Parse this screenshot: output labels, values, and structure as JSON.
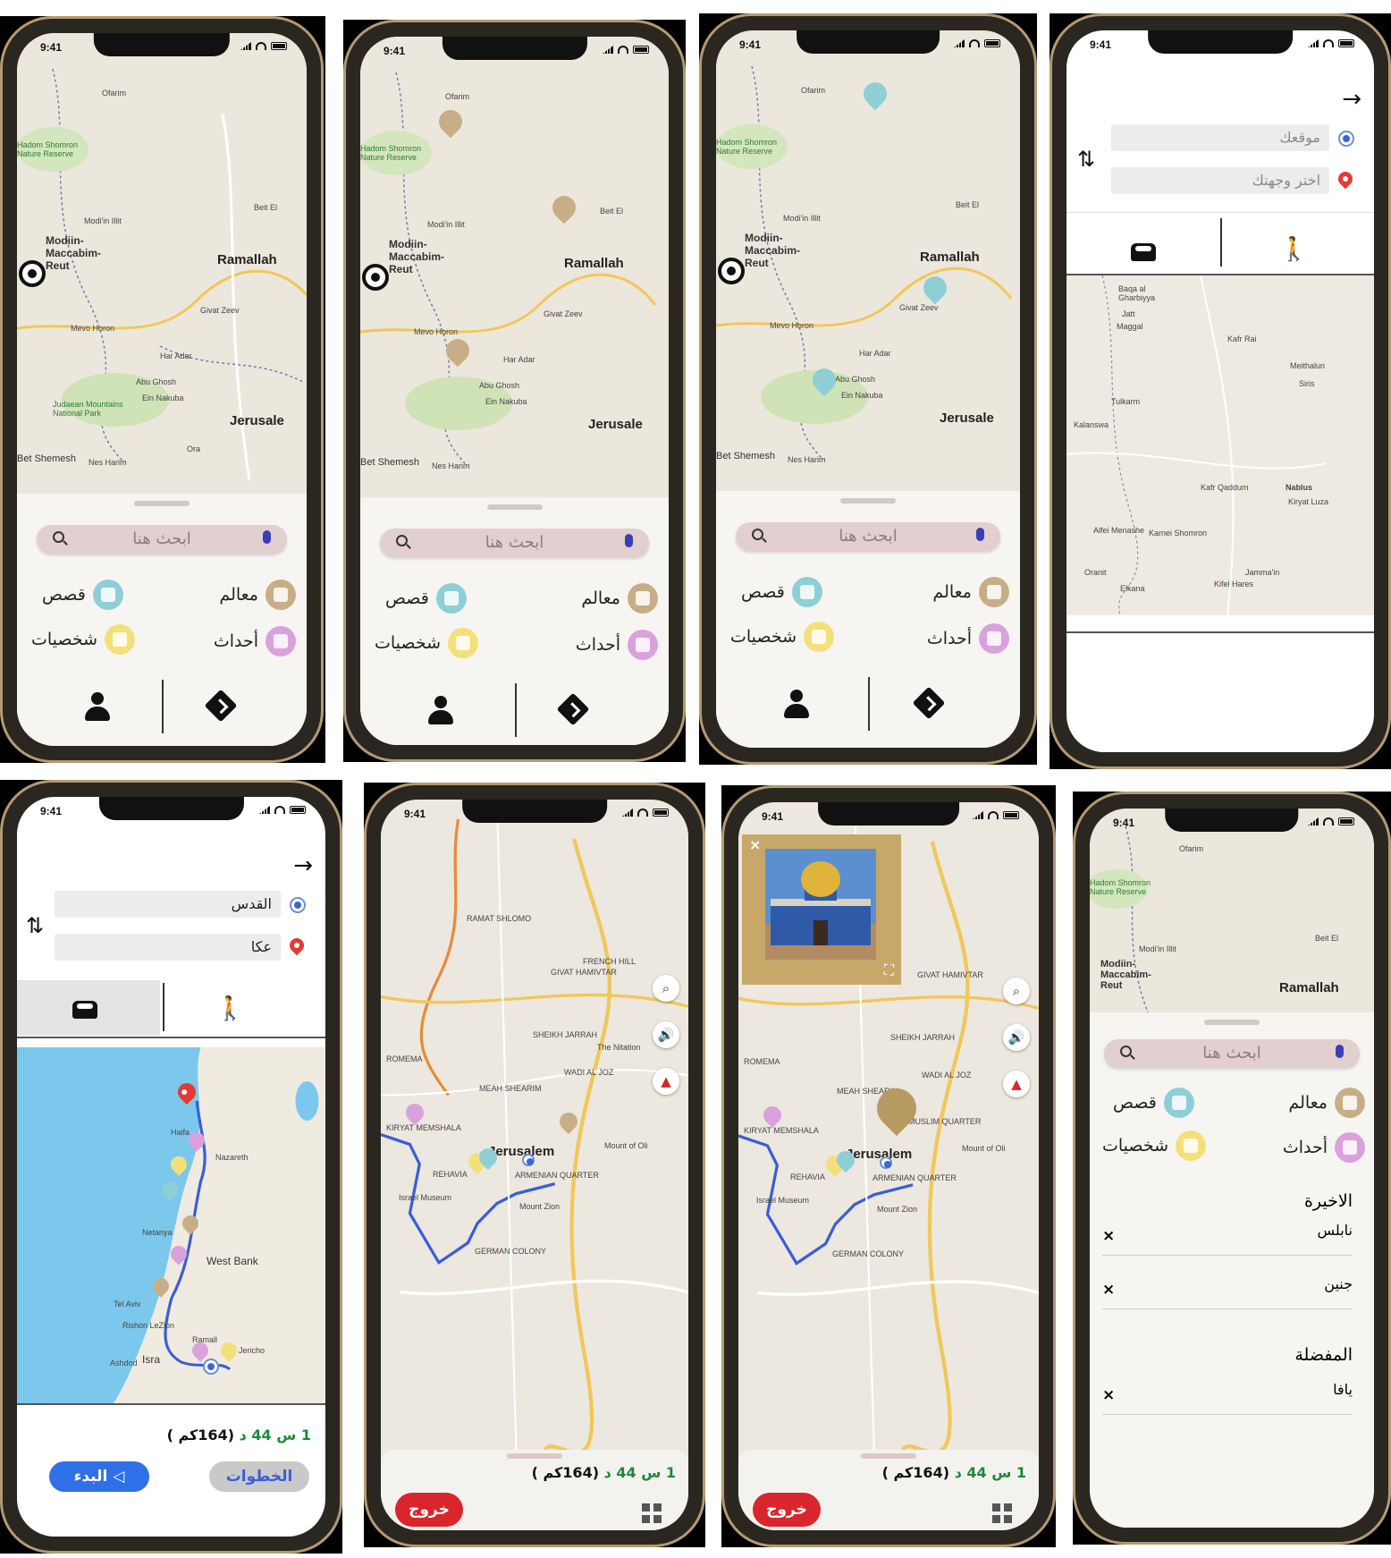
{
  "status_time": "9:41",
  "explore": {
    "search_placeholder": "ابحث هنا",
    "categories": {
      "monuments": "معالم",
      "stories": "قصص",
      "events": "أحداث",
      "persons": "شخصيات"
    },
    "map_labels": {
      "ofarim": "Ofarim",
      "hadom": "Hadom Shomron Nature Reserve",
      "modiin_illit": "Modi'in Illit",
      "modiin": "Modiin-Maccabim-Reut",
      "beit_el": "Beit El",
      "ramallah": "Ramallah",
      "givat_zeev": "Givat Zeev",
      "mevo_horon": "Mevo Horon",
      "har_adar": "Har Adar",
      "abu_ghosh": "Abu Ghosh",
      "ein_nakuba": "Ein Nakuba",
      "judaean": "Judaean Mountains National Park",
      "jerusalem": "Jerusale",
      "ora": "Ora",
      "bet_shemesh": "Bet Shemesh",
      "nes_harim": "Nes Harim"
    }
  },
  "route_empty": {
    "origin_placeholder": "موقعك",
    "destination_placeholder": "اختر وجهتك",
    "map_labels": {
      "baqa": "Baqa al Gharbiyya",
      "jatt": "Jatt",
      "maggal": "Maggal",
      "kafr_rai": "Kafr Rai",
      "meithalun": "Meithalun",
      "siris": "Siris",
      "tulkarm": "Tulkarm",
      "kalansua": "Kalanswa",
      "kafr_qaddum": "Kafr Qaddum",
      "nablus": "Nablus",
      "kiryat_luza": "Kiryat Luza",
      "alfei_menashe": "Alfei Menashe",
      "karnei": "Karnei Shomron",
      "oranit": "Oranit",
      "jammain": "Jamma'in",
      "elkana": "Elkana",
      "kfar_hares": "Kifel Hares"
    }
  },
  "route_filled": {
    "origin_value": "القدس",
    "destination_value": "عكا",
    "map_labels": {
      "haifa": "Haifa",
      "nazareth": "Nazareth",
      "netanya": "Netanya",
      "west_bank": "West Bank",
      "tel_aviv": "Tel Aviv",
      "rishon": "Rishon LeZion",
      "ashdod": "Ashdod",
      "israel": "Isra",
      "ramallah": "Ramall",
      "jericho": "Jericho"
    },
    "duration_green": "1 س 44 د",
    "distance": "(164كم )",
    "start_button": "البدء",
    "steps_button": "الخطوات"
  },
  "navigation": {
    "map_labels": {
      "ramat_shlomo": "RAMAT SHLOMO",
      "givat_hamivtar": "GIVAT HAMIVTAR",
      "french_hill": "FRENCH HILL",
      "romema": "ROMEMA",
      "sheikh_jarrah": "SHEIKH JARRAH",
      "wadi_al_joz": "WADI AL JOZ",
      "meah_shearim": "MEAH SHEARIM",
      "kiryat_menshalay": "KIRYAT MEMSHALA",
      "rehavia": "REHAVIA",
      "israel_museum": "Israel Museum",
      "jerusalem": "Jerusalem",
      "armenian": "ARMENIAN QUARTER",
      "mount_zion": "Mount Zion",
      "german_colony": "GERMAN COLONY",
      "mount_of_olives": "Mount of Oli",
      "the_nitation": "The Nitation",
      "muslim_quarter": "MUSLIM QUARTER"
    },
    "duration_green": "1 س 44 د",
    "distance": "(164كم )",
    "exit_button": "خروج"
  },
  "history": {
    "recent_header": "الاخيرة",
    "recent_items": [
      "نابلس",
      "جنين"
    ],
    "favorites_header": "المفضلة",
    "favorite_items": [
      "يافا"
    ]
  },
  "colors": {
    "accent_blue": "#2f6fe8",
    "exit_red": "#d9262c",
    "route_blue": "#3a5ed8",
    "duration_green": "#1b8a3a"
  }
}
